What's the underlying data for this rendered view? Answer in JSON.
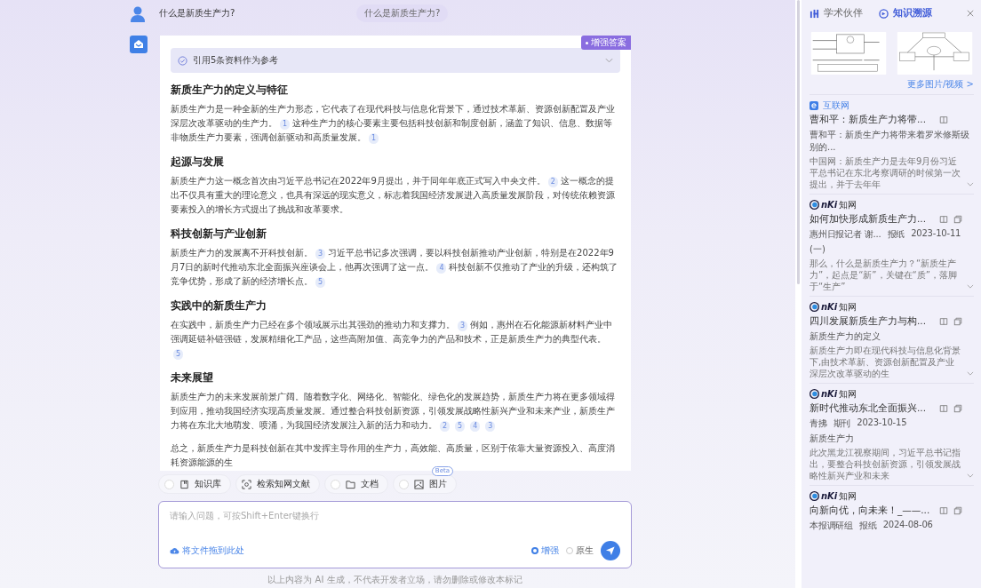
{
  "question": {
    "text": "什么是新质生产力?",
    "pill": "什么是新质生产力?"
  },
  "answer": {
    "badge": "增强答案",
    "reference": {
      "text": "引用5条资料作为参考",
      "expanded": false
    },
    "sections": [
      {
        "heading": "新质生产力的定义与特征",
        "parts": [
          {
            "kind": "text",
            "text": "新质生产力是一种全新的生产力形态，它代表了在现代科技与信息化背景下，通过技术革新、资源创新配置及产业深层次改革驱动的生产力。"
          },
          {
            "kind": "cite",
            "text": "1"
          },
          {
            "kind": "text",
            "text": "这种生产力的核心要素主要包括科技创新和制度创新，涵盖了知识、信息、数据等非物质生产力要素，强调创新驱动和高质量发展。"
          },
          {
            "kind": "cite",
            "text": "1"
          }
        ]
      },
      {
        "heading": "起源与发展",
        "parts": [
          {
            "kind": "text",
            "text": "新质生产力这一概念首次由习近平总书记在2022年9月提出，并于同年年底正式写入中央文件。"
          },
          {
            "kind": "cite",
            "text": "2"
          },
          {
            "kind": "text",
            "text": "这一概念的提出不仅具有重大的理论意义，也具有深远的现实意义，标志着我国经济发展进入高质量发展阶段，对传统依赖资源要素投入的增长方式提出了挑战和改革要求。"
          }
        ]
      },
      {
        "heading": "科技创新与产业创新",
        "parts": [
          {
            "kind": "text",
            "text": "新质生产力的发展离不开科技创新。"
          },
          {
            "kind": "cite",
            "text": "3"
          },
          {
            "kind": "text",
            "text": "习近平总书记多次强调，要以科技创新推动产业创新，特别是在2022年9月7日的新时代推动东北全面振兴座谈会上，他再次强调了这一点。"
          },
          {
            "kind": "cite",
            "text": "4"
          },
          {
            "kind": "text",
            "text": "科技创新不仅推动了产业的升级，还构筑了竞争优势，形成了新的经济增长点。"
          },
          {
            "kind": "cite",
            "text": "5"
          }
        ]
      },
      {
        "heading": "实践中的新质生产力",
        "parts": [
          {
            "kind": "text",
            "text": "在实践中，新质生产力已经在多个领域展示出其强劲的推动力和支撑力。"
          },
          {
            "kind": "cite",
            "text": "3"
          },
          {
            "kind": "text",
            "text": "例如，惠州在石化能源新材料产业中强调延链补链强链，发展精细化工产品，这些高附加值、高竞争力的产品和技术，正是新质生产力的典型代表。"
          },
          {
            "kind": "cite",
            "text": "5"
          }
        ]
      },
      {
        "heading": "未来展望",
        "parts": [
          {
            "kind": "text",
            "text": "新质生产力的未来发展前景广阔。随着数字化、网络化、智能化、绿色化的发展趋势，新质生产力将在更多领域得到应用，推动我国经济实现高质量发展。通过整合科技创新资源，引领发展战略性新兴产业和未来产业，新质生产力将在东北大地萌发、喷涌，为我国经济发展注入新的活力和动力。"
          },
          {
            "kind": "cite",
            "text": "2"
          },
          {
            "kind": "cite",
            "text": "5"
          },
          {
            "kind": "cite",
            "text": "4"
          },
          {
            "kind": "cite",
            "text": "3"
          }
        ]
      },
      {
        "parts": [
          {
            "kind": "text",
            "text": "总之，新质生产力是科技创新在其中发挥主导作用的生产力，高效能、高质量，区别于依靠大量资源投入、高度消耗资源能源的生"
          }
        ]
      }
    ]
  },
  "tools": [
    {
      "kind": "toggle",
      "label": "知识库",
      "checked": false
    },
    {
      "kind": "action",
      "label": "检索知网文献"
    },
    {
      "kind": "toggle",
      "label": "文档",
      "checked": false
    },
    {
      "kind": "toggle",
      "label": "图片",
      "checked": false,
      "tag": "Beta"
    }
  ],
  "input": {
    "placeholder": "请输入问题，可按Shift+Enter键换行",
    "upload": "将文件拖到此处",
    "modes": [
      {
        "label": "增强",
        "selected": true
      },
      {
        "label": "原生",
        "selected": false
      }
    ]
  },
  "footer": "以上内容为 AI 生成，不代表开发者立场，请勿删除或修改本标记",
  "panel": {
    "tabs": [
      {
        "label": "学术伙伴",
        "selected": false
      },
      {
        "label": "知识溯源",
        "selected": true
      }
    ],
    "more": "更多图片/视频 >",
    "sources": [
      {
        "source": {
          "kind": "web",
          "name": "互联网"
        },
        "title": "曹和平：新质生产力将带...",
        "copy": false,
        "subtitle": "曹和平：新质生产力将带来着罗米修斯级别的...",
        "snippet": "中国网：新质生产力是去年9月份习近平总书记在东北考察调研的时候第一次提出，并于去年年"
      },
      {
        "source": {
          "kind": "cnki",
          "mark": "nKi",
          "name": "知网"
        },
        "title": "如何加快形成新质生产力...",
        "copy": true,
        "meta": [
          "惠州日报记者 谢...",
          "报纸",
          "2023-10-11"
        ],
        "subtitle": "(一)",
        "snippet": "那么，什么是新质生产力？“新质生产力”，起点是“新”，关键在“质”，落脚于“生产”"
      },
      {
        "source": {
          "kind": "cnki",
          "mark": "nKi",
          "name": "知网"
        },
        "title": "四川发展新质生产力与构...",
        "copy": true,
        "subtitle": "新质生产力的定义",
        "snippet": "新质生产力即在现代科技与信息化背景下,由技术革新、资源创新配置及产业深层次改革驱动的生"
      },
      {
        "source": {
          "kind": "cnki",
          "mark": "nKi",
          "name": "知网"
        },
        "title": "新时代推动东北全面振兴...",
        "copy": true,
        "meta": [
          "青拂",
          "期刊",
          "2023-10-15"
        ],
        "subtitle": "新质生产力",
        "snippet": "此次黑龙江视察期间，习近平总书记指出，要整合科技创新资源，引领发展战略性新兴产业和未来"
      },
      {
        "source": {
          "kind": "cnki",
          "mark": "nKi",
          "name": "知网"
        },
        "title": "向新向优，向未来！_——...",
        "copy": true,
        "meta": [
          "本报调研组",
          "报纸",
          "2024-08-06"
        ]
      }
    ]
  }
}
